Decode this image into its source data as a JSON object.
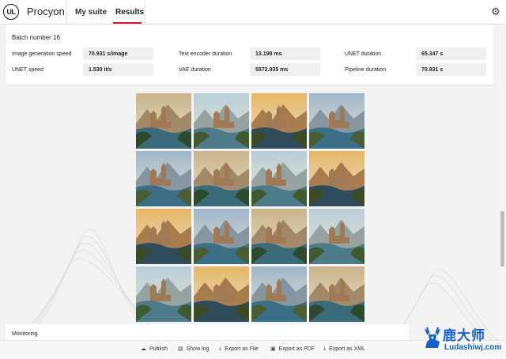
{
  "header": {
    "logo_text": "UL",
    "app_title": "Procyon",
    "tabs": [
      {
        "label": "My suite",
        "active": false
      },
      {
        "label": "Results",
        "active": true
      }
    ],
    "accent_color": "#e0192b"
  },
  "batch": {
    "title": "Batch number 16",
    "metrics": [
      {
        "label": "Image generation speed",
        "value": "70.931 s/image"
      },
      {
        "label": "Text encoder duration",
        "value": "13.198 ms"
      },
      {
        "label": "UNET duration",
        "value": "65.347 s"
      },
      {
        "label": "UNET speed",
        "value": "1.530 it/s"
      },
      {
        "label": "VAE duration",
        "value": "5572.935 ms"
      },
      {
        "label": "Pipeline duration",
        "value": "70.931 s"
      }
    ]
  },
  "gallery": {
    "image_count": 16
  },
  "monitoring": {
    "label": "Monitoring"
  },
  "actions": [
    {
      "label": "Publish",
      "icon": "cloud-upload-icon"
    },
    {
      "label": "Show log",
      "icon": "document-icon"
    },
    {
      "label": "Export as File",
      "icon": "download-icon"
    },
    {
      "label": "Export as PDF",
      "icon": "save-icon"
    },
    {
      "label": "Export as XML",
      "icon": "download-icon"
    }
  ],
  "watermark": {
    "main": "鹿大师",
    "sub": "Ludashiwj.com"
  }
}
